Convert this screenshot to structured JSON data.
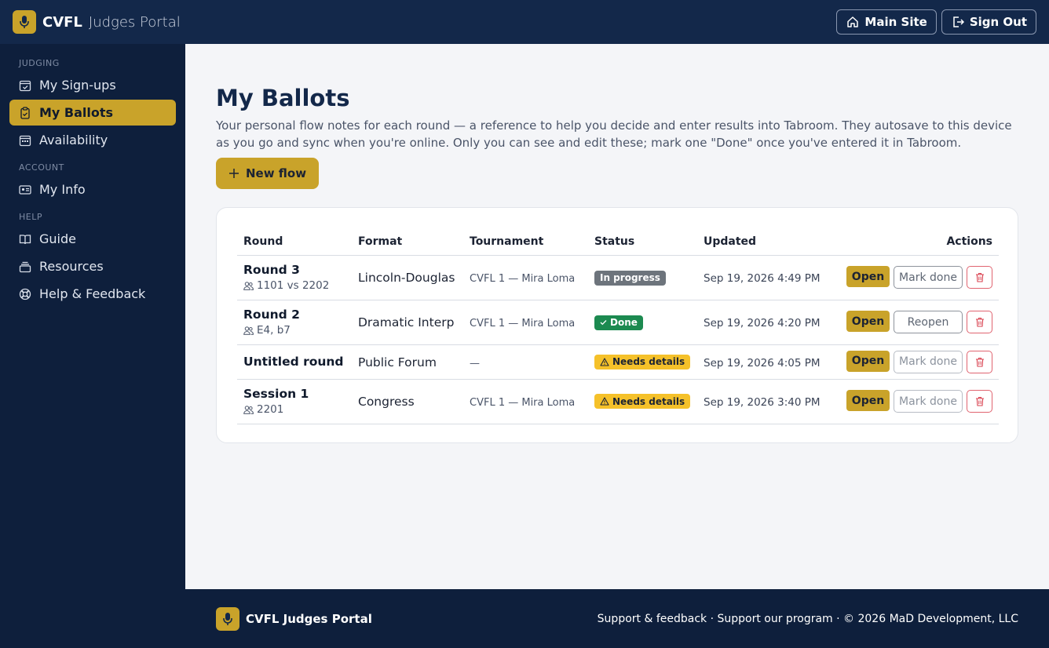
{
  "header": {
    "brand": "CVFL",
    "subtitle": "Judges Portal",
    "main_site": "Main Site",
    "sign_out": "Sign Out"
  },
  "sidebar": {
    "sections": [
      {
        "label": "JUDGING",
        "items": [
          {
            "label": "My Sign-ups",
            "icon": "calendar-check-icon",
            "active": false
          },
          {
            "label": "My Ballots",
            "icon": "clipboard-icon",
            "active": true
          },
          {
            "label": "Availability",
            "icon": "calendar-icon",
            "active": false
          }
        ]
      },
      {
        "label": "ACCOUNT",
        "items": [
          {
            "label": "My Info",
            "icon": "id-card-icon",
            "active": false
          }
        ]
      },
      {
        "label": "HELP",
        "items": [
          {
            "label": "Guide",
            "icon": "book-icon",
            "active": false
          },
          {
            "label": "Resources",
            "icon": "stack-icon",
            "active": false
          },
          {
            "label": "Help & Feedback",
            "icon": "lifebuoy-icon",
            "active": false
          }
        ]
      }
    ]
  },
  "main": {
    "title": "My Ballots",
    "description": "Your personal flow notes for each round — a reference to help you decide and enter results into Tabroom. They autosave to this device as you go and sync when you're online. Only you can see and edit these; mark one \"Done\" once you've entered it in Tabroom.",
    "new_flow": "New flow"
  },
  "table": {
    "headers": {
      "round": "Round",
      "format": "Format",
      "tournament": "Tournament",
      "status": "Status",
      "updated": "Updated",
      "actions": "Actions"
    },
    "rows": [
      {
        "round": "Round 3",
        "sub": "1101 vs 2202",
        "format": "Lincoln-Douglas",
        "tournament": "CVFL 1 — Mira Loma",
        "status": "In progress",
        "status_kind": "progress",
        "updated": "Sep 19, 2026 4:49 PM",
        "open": "Open",
        "mark": "Mark done"
      },
      {
        "round": "Round 2",
        "sub": "E4, b7",
        "format": "Dramatic Interp",
        "tournament": "CVFL 1 — Mira Loma",
        "status": "Done",
        "status_kind": "done",
        "updated": "Sep 19, 2026 4:20 PM",
        "open": "Open",
        "mark": "Reopen"
      },
      {
        "round": "Untitled round",
        "sub": "",
        "format": "Public Forum",
        "tournament": "—",
        "status": "Needs details",
        "status_kind": "need",
        "updated": "Sep 19, 2026 4:05 PM",
        "open": "Open",
        "mark": "Mark done"
      },
      {
        "round": "Session 1",
        "sub": "2201",
        "format": "Congress",
        "tournament": "CVFL 1 — Mira Loma",
        "status": "Needs details",
        "status_kind": "need",
        "updated": "Sep 19, 2026 3:40 PM",
        "open": "Open",
        "mark": "Mark done"
      }
    ]
  },
  "footer": {
    "brand": "CVFL Judges Portal",
    "links": "Support & feedback · Support our program · © 2026 MaD Development, LLC"
  },
  "colors": {
    "navy": "#13284a",
    "sidebar": "#0e1f3c",
    "gold": "#c9a32a",
    "done_green": "#1c8a50",
    "needs_yellow": "#f5c12a",
    "progress_gray": "#6d747c",
    "delete_red": "#e06470"
  }
}
